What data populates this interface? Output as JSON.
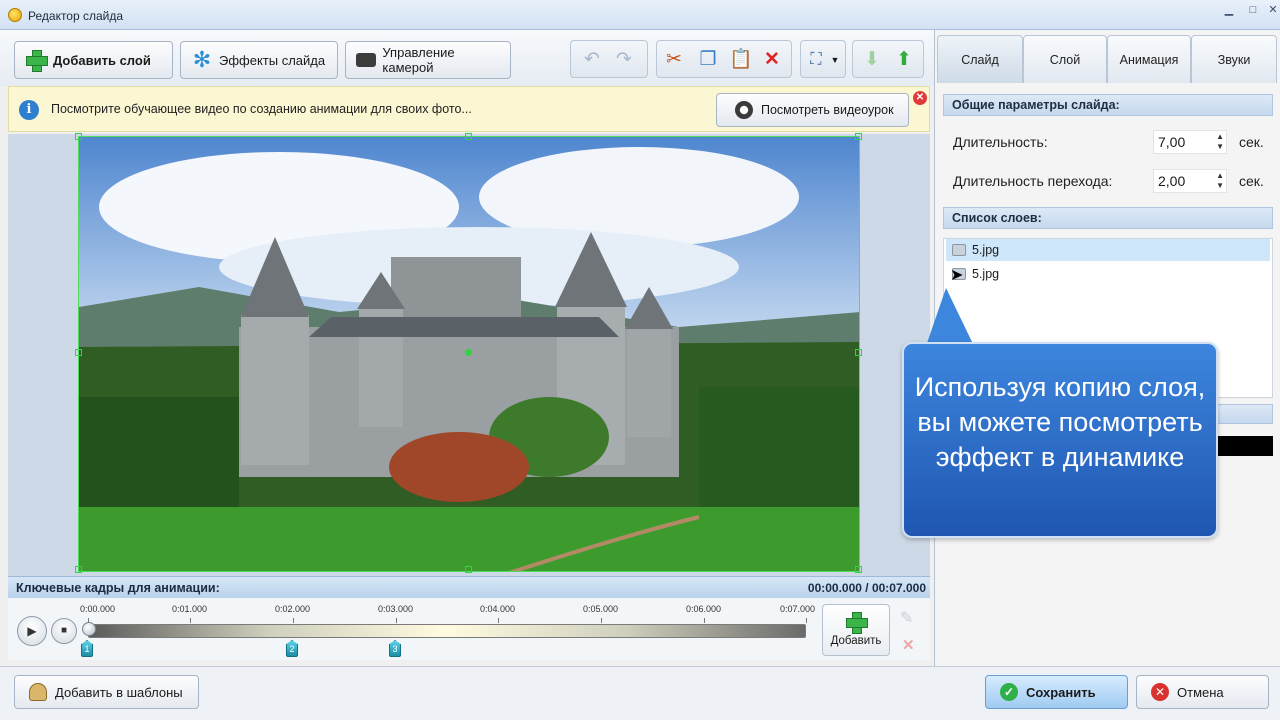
{
  "window": {
    "title": "Редактор слайда"
  },
  "toolbar": {
    "add_layer": "Добавить слой",
    "slide_effects": "Эффекты слайда",
    "camera_control": "Управление камерой"
  },
  "info_bar": {
    "text": "Посмотрите обучающее видео по созданию анимации для своих фото...",
    "video_button": "Посмотреть видеоурок"
  },
  "keyframes": {
    "title": "Ключевые кадры для анимации:",
    "time": "00:00.000 / 00:07.000",
    "ticks": [
      "0:00.000",
      "0:01.000",
      "0:02.000",
      "0:03.000",
      "0:04.000",
      "0:05.000",
      "0:06.000",
      "0:07.000"
    ],
    "markers": [
      "1",
      "2",
      "3"
    ],
    "add_label": "Добавить"
  },
  "bottom": {
    "add_templates": "Добавить в шаблоны",
    "save": "Сохранить",
    "cancel": "Отмена"
  },
  "right_panel": {
    "tabs": [
      "Слайд",
      "Слой",
      "Анимация",
      "Звуки"
    ],
    "active_tab": "Слайд",
    "general_header": "Общие параметры слайда:",
    "duration_label": "Длительность:",
    "duration_value": "7,00",
    "transition_label": "Длительность перехода:",
    "transition_value": "2,00",
    "unit": "сек.",
    "layers_header": "Список слоев:",
    "layers": [
      "5.jpg",
      "5.jpg"
    ]
  },
  "callout": {
    "text": "Используя копию слоя, вы можете посмотреть эффект в динамике"
  },
  "colors": {
    "callout": "#2e6fcb",
    "selection": "#cfe7fb",
    "frame_handles": "#2fd43f"
  }
}
